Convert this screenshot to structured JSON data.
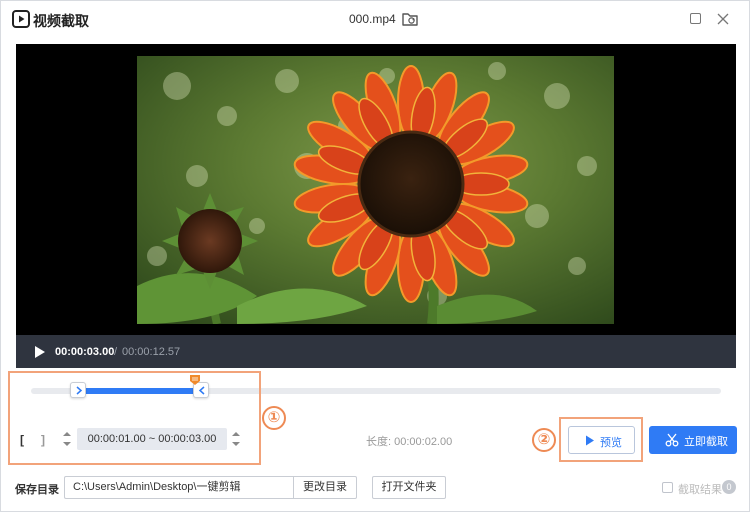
{
  "app": {
    "title": "视频截取",
    "file_name": "000.mp4"
  },
  "player": {
    "current_time": "00:00:03.00",
    "separator": "/",
    "total_time": "00:00:12.57"
  },
  "timeline": {
    "selection_start_fraction": 0.068,
    "selection_end_fraction": 0.247,
    "playhead_fraction": 0.238
  },
  "range": {
    "bracket_start": "[",
    "bracket_end": "]",
    "value": "00:00:01.00 ~ 00:00:03.00",
    "duration_label": "长度: 00:00:02.00"
  },
  "annotations": {
    "marker_1": "①",
    "marker_2": "②"
  },
  "actions": {
    "preview_label": "预览",
    "cut_label": "立即截取"
  },
  "output": {
    "save_dir_label": "保存目录",
    "path_value": "C:\\Users\\Admin\\Desktop\\一键剪辑",
    "change_dir_label": "更改目录",
    "open_folder_label": "打开文件夹",
    "result_label": "截取结果",
    "result_count": "0"
  },
  "colors": {
    "accent": "#2f7bf5",
    "annotation": "#ee8a54",
    "control_bar": "#2f343f"
  }
}
